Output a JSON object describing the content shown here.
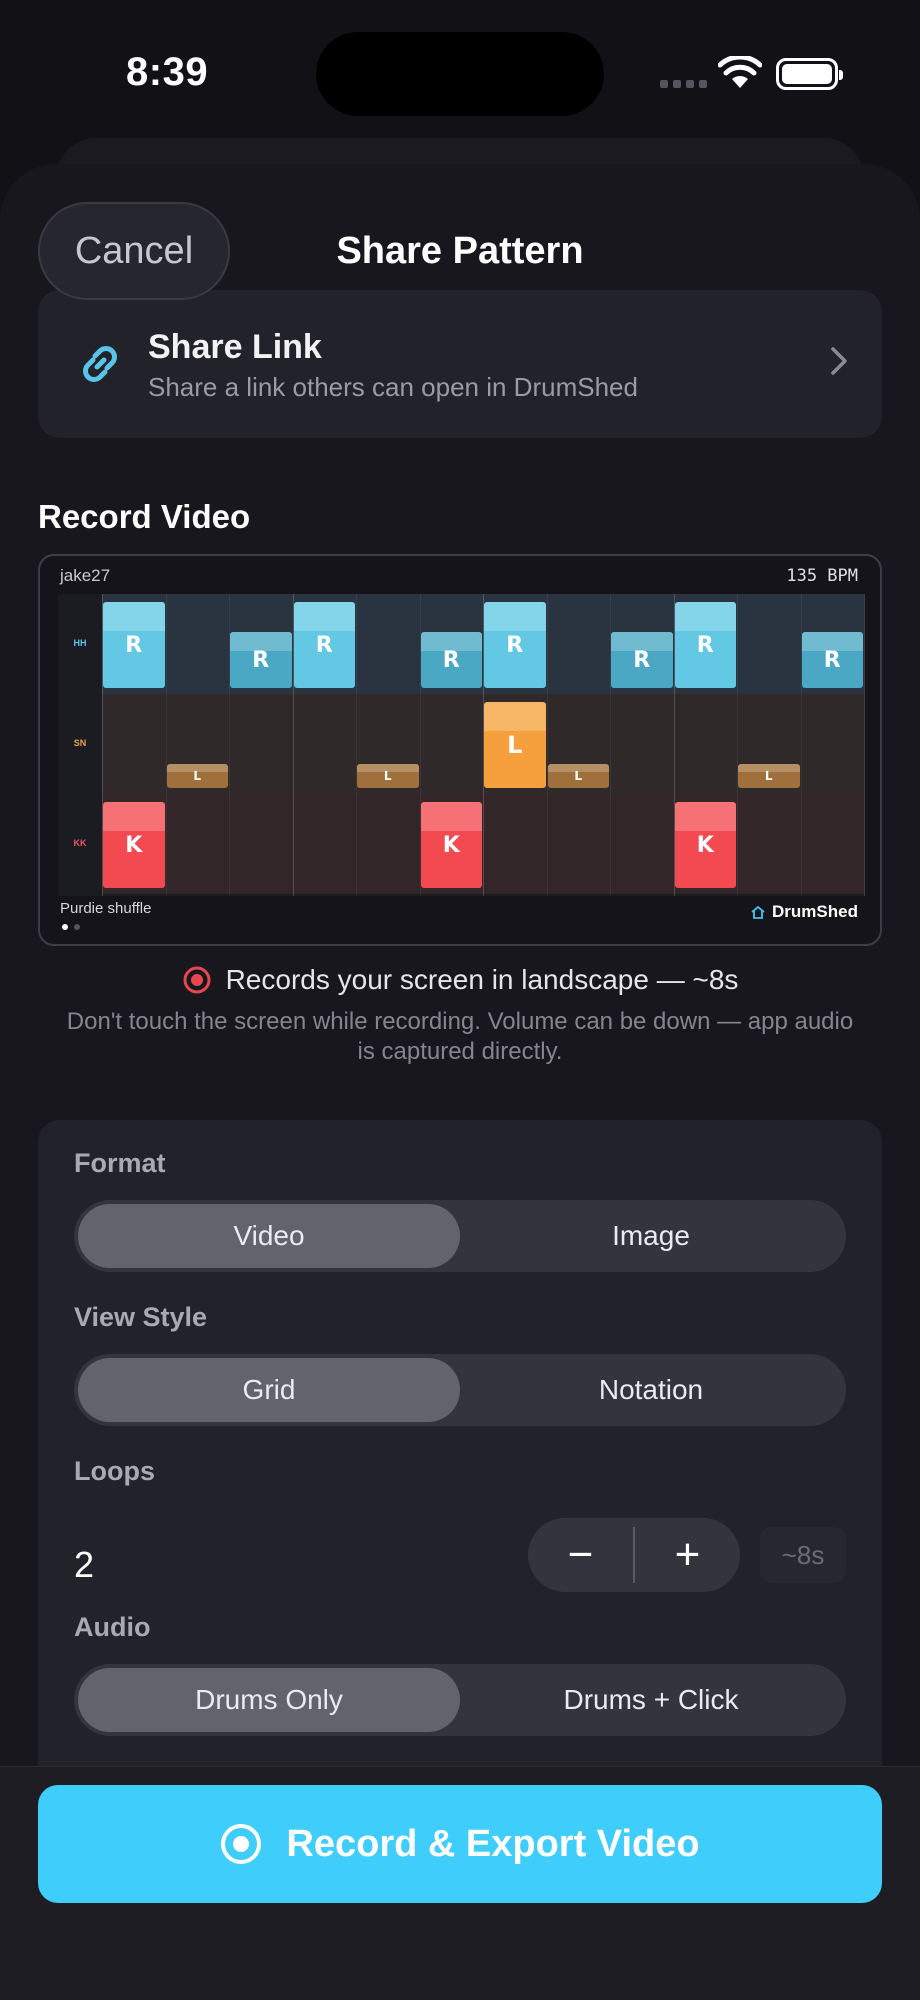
{
  "status_bar": {
    "time": "8:39"
  },
  "header": {
    "cancel_label": "Cancel",
    "title": "Share Pattern"
  },
  "share_link": {
    "title": "Share Link",
    "subtitle": "Share a link others can open in DrumShed"
  },
  "record_section": {
    "title": "Record Video"
  },
  "preview": {
    "user": "jake27",
    "bpm": "135 BPM",
    "pattern_name": "Purdie shuffle",
    "brand": "DrumShed",
    "lanes": [
      {
        "label": "HH",
        "color": "#5cc7e6"
      },
      {
        "label": "SN",
        "color": "#e8a04a"
      },
      {
        "label": "KK",
        "color": "#f2535a"
      }
    ],
    "notes": {
      "hh": [
        {
          "step": 0,
          "text": "R",
          "accent": true
        },
        {
          "step": 2,
          "text": "R",
          "accent": false
        },
        {
          "step": 3,
          "text": "R",
          "accent": true
        },
        {
          "step": 5,
          "text": "R",
          "accent": false
        },
        {
          "step": 6,
          "text": "R",
          "accent": true
        },
        {
          "step": 8,
          "text": "R",
          "accent": false
        },
        {
          "step": 9,
          "text": "R",
          "accent": true
        },
        {
          "step": 11,
          "text": "R",
          "accent": false
        }
      ],
      "sn": [
        {
          "step": 1,
          "text": "L",
          "accent": false
        },
        {
          "step": 4,
          "text": "L",
          "accent": false
        },
        {
          "step": 6,
          "text": "L",
          "accent": true
        },
        {
          "step": 7,
          "text": "L",
          "accent": false
        },
        {
          "step": 10,
          "text": "L",
          "accent": false
        }
      ],
      "kk": [
        {
          "step": 0,
          "text": "K",
          "accent": true
        },
        {
          "step": 5,
          "text": "K",
          "accent": true
        },
        {
          "step": 9,
          "text": "K",
          "accent": true
        }
      ]
    },
    "page_index": 1,
    "page_count": 2
  },
  "record_info": {
    "text": "Records your screen in landscape — ~8s",
    "note": "Don't touch the screen while recording. Volume can be down — app audio is captured directly."
  },
  "options": {
    "format": {
      "label": "Format",
      "options": [
        "Video",
        "Image"
      ],
      "selected": "Video"
    },
    "view_style": {
      "label": "View Style",
      "options": [
        "Grid",
        "Notation"
      ],
      "selected": "Grid"
    },
    "loops": {
      "label": "Loops",
      "value": "2",
      "minus": "−",
      "plus": "+",
      "duration": "~8s"
    },
    "audio": {
      "label": "Audio",
      "options": [
        "Drums Only",
        "Drums + Click"
      ],
      "selected": "Drums Only"
    }
  },
  "primary_action": {
    "label": "Record & Export Video",
    "color": "#3fcdfb"
  }
}
